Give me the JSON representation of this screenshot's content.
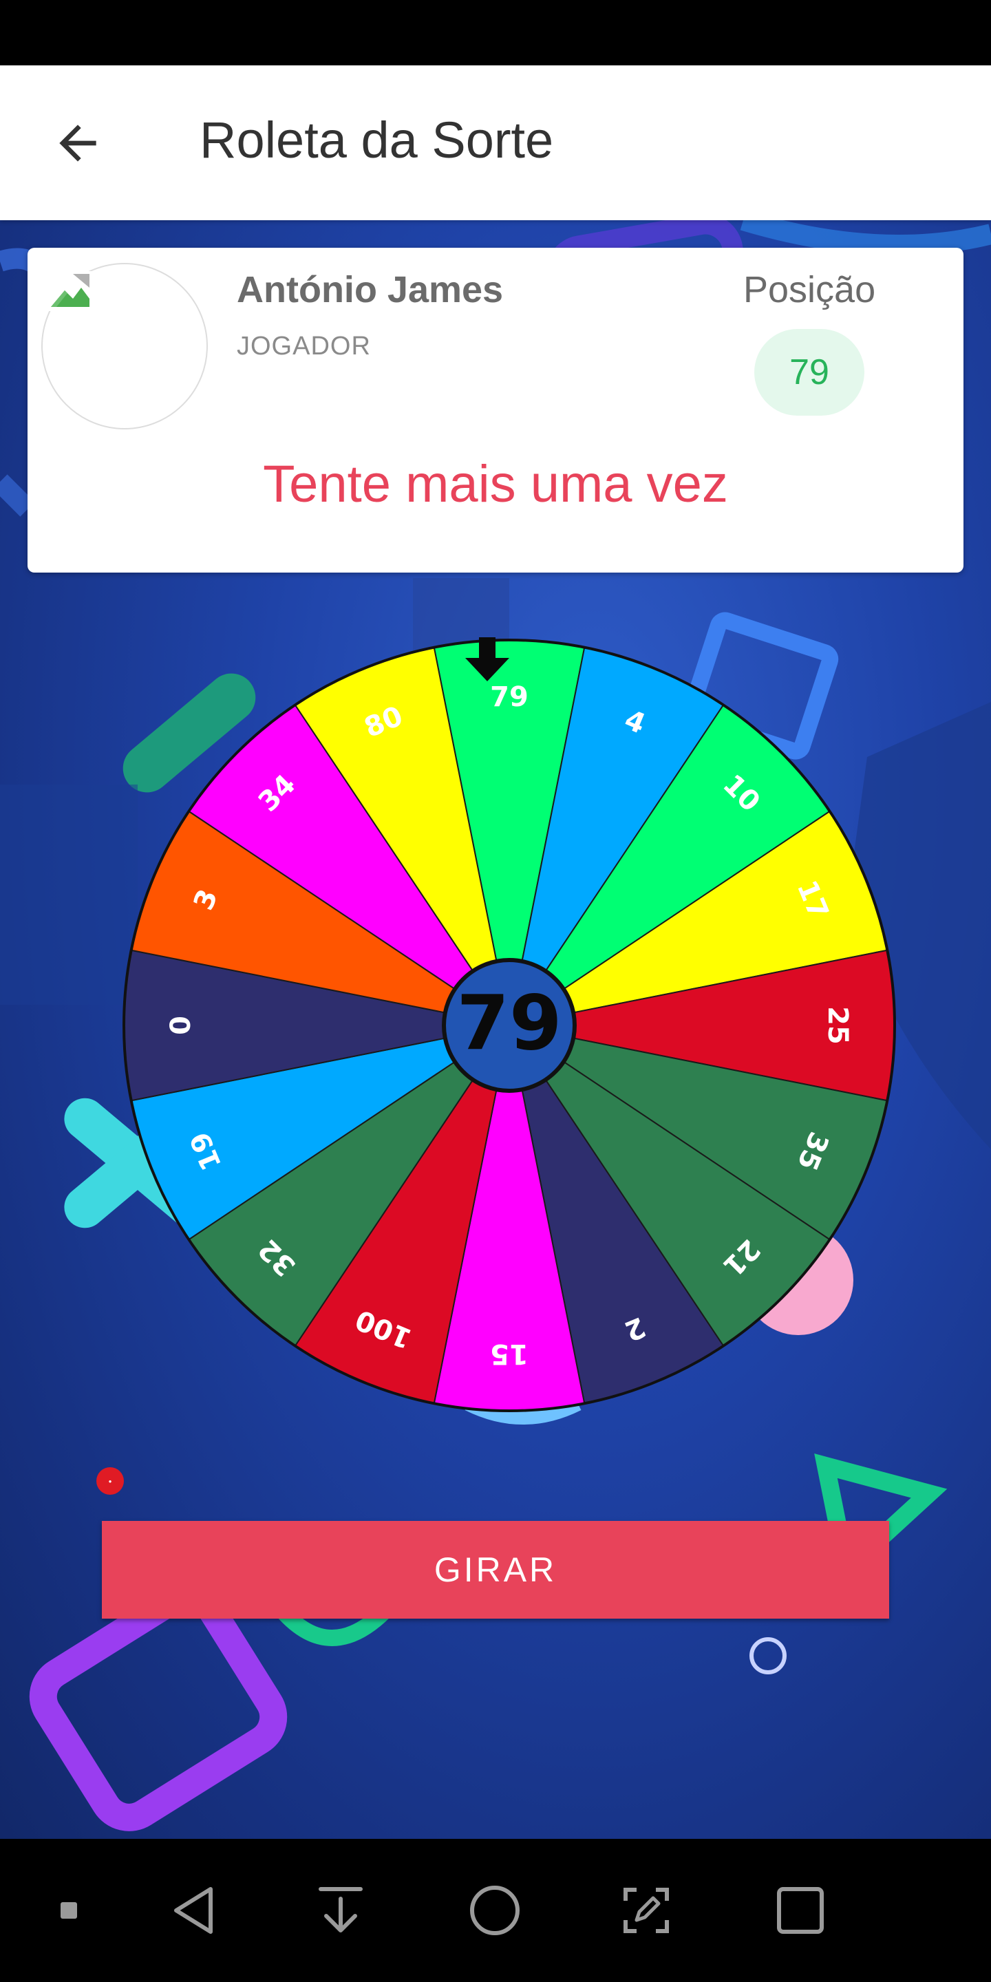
{
  "app_bar": {
    "title": "Roleta da Sorte"
  },
  "player": {
    "name": "António James",
    "role": "JOGADOR"
  },
  "position": {
    "label": "Posição",
    "value": "79"
  },
  "result_message": "Tente mais uma vez",
  "wheel": {
    "center_value": "79",
    "segments": [
      {
        "label": "79",
        "color": "#00ff73"
      },
      {
        "label": "4",
        "color": "#00a9ff"
      },
      {
        "label": "10",
        "color": "#00ff73"
      },
      {
        "label": "17",
        "color": "#ffff00"
      },
      {
        "label": "25",
        "color": "#dc0a24"
      },
      {
        "label": "35",
        "color": "#2e8050"
      },
      {
        "label": "21",
        "color": "#2e8050"
      },
      {
        "label": "2",
        "color": "#2e2e6e"
      },
      {
        "label": "15",
        "color": "#ff00ff"
      },
      {
        "label": "100",
        "color": "#dc0a24"
      },
      {
        "label": "32",
        "color": "#2e8050"
      },
      {
        "label": "19",
        "color": "#00a9ff"
      },
      {
        "label": "0",
        "color": "#2e2e6e"
      },
      {
        "label": "3",
        "color": "#ff5500"
      },
      {
        "label": "34",
        "color": "#ff00ff"
      },
      {
        "label": "80",
        "color": "#ffff00"
      }
    ]
  },
  "spin_button": {
    "label": "GIRAR"
  },
  "colors": {
    "accent": "#e8435a",
    "position_green": "#27b35a"
  },
  "nav_bar": {
    "icons": [
      "square-dot-icon",
      "back-triangle-icon",
      "download-icon",
      "home-circle-icon",
      "edit-screen-icon",
      "recents-square-icon"
    ]
  }
}
